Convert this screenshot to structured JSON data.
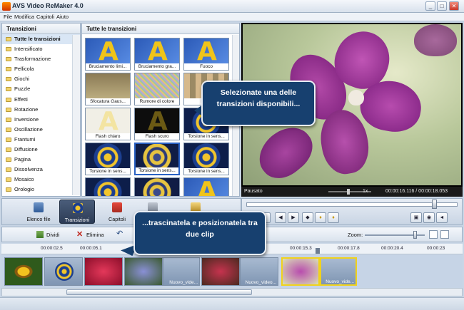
{
  "app": {
    "title": "AVS Video ReMaker 4.0"
  },
  "window_controls": {
    "minimize": "_",
    "maximize": "□",
    "close": "✕"
  },
  "menu": [
    "File",
    "Modifica",
    "Capitoli",
    "Aiuto"
  ],
  "categories_panel": {
    "title": "Transizioni",
    "items": [
      "Tutte le transizioni",
      "Intensificato",
      "Trasformazione",
      "Pellicola",
      "Giochi",
      "Puzzle",
      "Effetti",
      "Rotazione",
      "Inversione",
      "Oscillazione",
      "Frantumi",
      "Diffusione",
      "Pagina",
      "Dissolvenza",
      "Mosaico",
      "Orologio"
    ]
  },
  "transitions_panel": {
    "title": "Tutte le transizioni",
    "thumbs": [
      "Bruciamento limi...",
      "Bruciamento gra...",
      "Fuoco",
      "Sfocatura Gaus...",
      "Rumore di colore",
      "Pixell",
      "Flash chiaro",
      "Flash scuro",
      "Torsione in sens...",
      "Torsione in sens...",
      "Torsione in sens...",
      "Torsione in sens...",
      "",
      "",
      ""
    ]
  },
  "player": {
    "status": "Pausato",
    "speed": "1x",
    "time": "00:00:16.116 / 00:00:18.053"
  },
  "toolbar": {
    "buttons": [
      "Elenco file",
      "Transizioni",
      "Capitoli",
      "",
      ""
    ]
  },
  "timeline_toolbar": {
    "split": "Dividi",
    "delete": "Elimina",
    "zoom_label": "Zoom:"
  },
  "ruler": [
    "00:00:02.5",
    "00:00:05.1",
    "00:00:15.3",
    "00:00:17.8",
    "00:00:20.4",
    "00:00:23"
  ],
  "clips": [
    "",
    "",
    "",
    "Nuovo_vide...",
    "Nuovo_video...",
    "Nuovo_video...",
    "",
    "Nuovo_vide..."
  ],
  "callouts": {
    "top": "Selezionate una delle transizioni disponibili...",
    "bottom": "...trascinatela e posizionatela tra due clip"
  }
}
